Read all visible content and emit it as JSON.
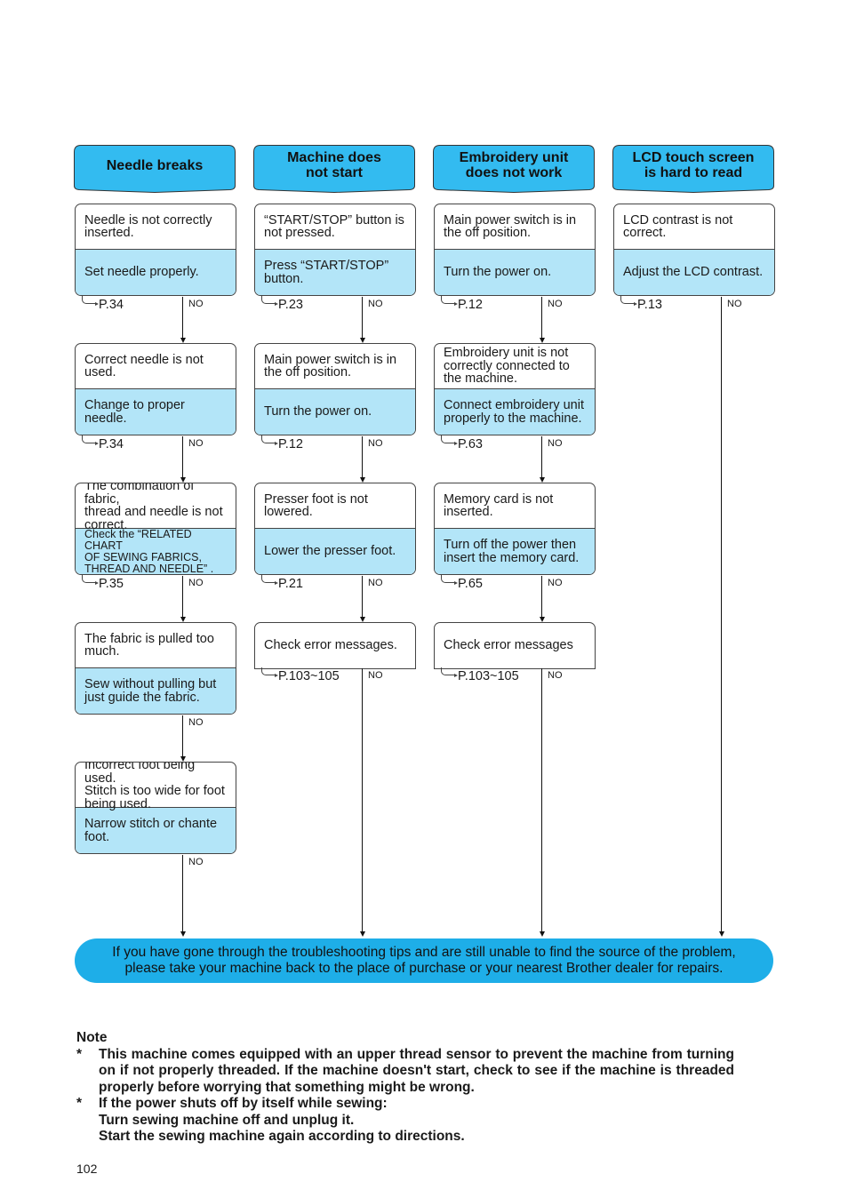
{
  "columns": [
    {
      "header": [
        "Needle breaks"
      ],
      "steps": [
        {
          "cause": [
            "Needle is not correctly",
            "inserted."
          ],
          "fix": [
            "Set needle properly."
          ],
          "ref": "P.34",
          "no": "NO"
        },
        {
          "cause": [
            "Correct needle is not",
            "used."
          ],
          "fix": [
            "Change to proper needle."
          ],
          "ref": "P.34",
          "no": "NO"
        },
        {
          "cause": [
            "The combination of fabric,",
            "thread and needle is not",
            "correct."
          ],
          "fix": [
            "Check the “RELATED CHART",
            "OF SEWING FABRICS,",
            "THREAD AND NEEDLE” ."
          ],
          "ref": "P.35",
          "no": "NO"
        },
        {
          "cause": [
            "The fabric is pulled too",
            "much."
          ],
          "fix": [
            "Sew without pulling but",
            "just guide the fabric."
          ],
          "ref": "",
          "no": "NO"
        },
        {
          "cause": [
            "Incorrect foot being used.",
            "Stitch is too wide for foot",
            "being used."
          ],
          "fix": [
            "Narrow stitch or chante",
            "foot."
          ],
          "ref": "",
          "no": "NO"
        }
      ]
    },
    {
      "header": [
        "Machine does",
        "not start"
      ],
      "steps": [
        {
          "cause": [
            "“START/STOP” button is",
            "not pressed."
          ],
          "fix": [
            "Press “START/STOP”",
            "button."
          ],
          "ref": "P.23",
          "no": "NO"
        },
        {
          "cause": [
            "Main power switch is in",
            "the off position."
          ],
          "fix": [
            "Turn the power on."
          ],
          "ref": "P.12",
          "no": "NO"
        },
        {
          "cause": [
            "Presser foot is not",
            "lowered."
          ],
          "fix": [
            "Lower the presser foot."
          ],
          "ref": "P.21",
          "no": "NO"
        },
        {
          "cause": [
            "Check error messages."
          ],
          "fix": null,
          "ref": "P.103~105",
          "no": "NO"
        }
      ]
    },
    {
      "header": [
        "Embroidery unit",
        "does not work"
      ],
      "steps": [
        {
          "cause": [
            "Main power switch is in",
            "the off position."
          ],
          "fix": [
            "Turn the power on."
          ],
          "ref": "P.12",
          "no": "NO"
        },
        {
          "cause": [
            "Embroidery unit is not",
            "correctly connected to",
            "the machine."
          ],
          "fix": [
            "Connect embroidery unit",
            "properly to the machine."
          ],
          "ref": "P.63",
          "no": "NO"
        },
        {
          "cause": [
            "Memory card is not",
            "inserted."
          ],
          "fix": [
            "Turn off the power then",
            "insert the memory card."
          ],
          "ref": "P.65",
          "no": "NO"
        },
        {
          "cause": [
            "Check error messages"
          ],
          "fix": null,
          "ref": "P.103~105",
          "no": "NO"
        }
      ]
    },
    {
      "header": [
        "LCD touch screen",
        "is hard to read"
      ],
      "steps": [
        {
          "cause": [
            "LCD contrast is not",
            "correct."
          ],
          "fix": [
            "Adjust the LCD contrast."
          ],
          "ref": "P.13",
          "no": "NO"
        }
      ]
    }
  ],
  "final_message": [
    "If you have gone through the troubleshooting tips and are still unable to find the source of the problem,",
    "please take your machine back to the place of purchase or your nearest Brother dealer for repairs."
  ],
  "note": {
    "title": "Note",
    "items": [
      {
        "bullet": "*",
        "lines": [
          "This machine comes equipped with an upper thread sensor to prevent the machine from turning on if not properly threaded.  If the machine doesn't start, check to see if the machine is threaded properly before worrying that something might be wrong."
        ]
      },
      {
        "bullet": "*",
        "lines": [
          "If the power shuts off by itself while sewing:",
          "Turn sewing machine off and unplug it.",
          "Start the sewing machine again according to directions."
        ]
      }
    ]
  },
  "page_number": "102",
  "colors": {
    "header": "#33bbf0",
    "fix_fill": "#b3e5f8",
    "final_fill": "#1eaee8"
  }
}
